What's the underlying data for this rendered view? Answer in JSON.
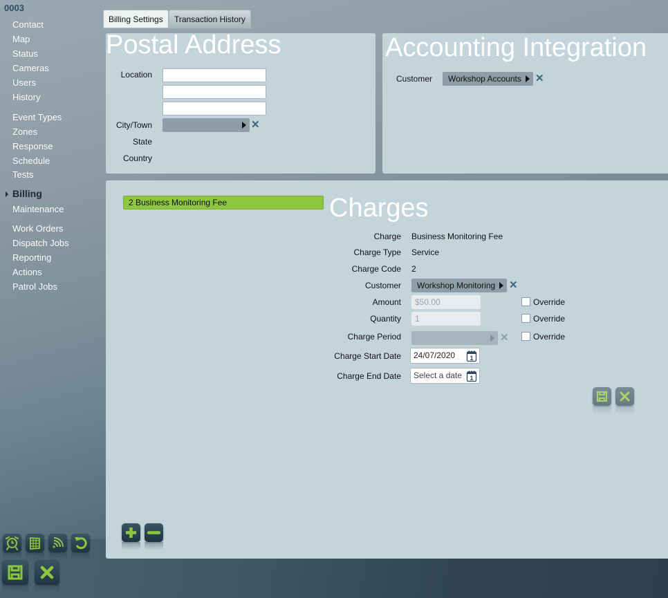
{
  "sidebar": {
    "record_id": "0003",
    "items": [
      {
        "label": "Contact"
      },
      {
        "label": "Map"
      },
      {
        "label": "Status"
      },
      {
        "label": "Cameras"
      },
      {
        "label": "Users"
      },
      {
        "label": "History"
      },
      {
        "label": "Event Types"
      },
      {
        "label": "Zones"
      },
      {
        "label": "Response"
      },
      {
        "label": "Schedule"
      },
      {
        "label": "Tests"
      },
      {
        "label": "Billing",
        "active": true
      },
      {
        "label": "Maintenance"
      },
      {
        "label": "Work Orders"
      },
      {
        "label": "Dispatch Jobs"
      },
      {
        "label": "Reporting"
      },
      {
        "label": "Actions"
      },
      {
        "label": "Patrol Jobs"
      }
    ],
    "toolbar_icons": [
      "alarm-clock-icon",
      "building-icon",
      "signal-icon",
      "undo-icon"
    ],
    "save_icon": "save-icon",
    "cancel_icon": "close-icon"
  },
  "tabs": [
    {
      "label": "Billing Settings",
      "active": true
    },
    {
      "label": "Transaction History",
      "active": false
    }
  ],
  "postal_address": {
    "title": "Postal Address",
    "location_label": "Location",
    "location_lines": [
      "",
      "",
      ""
    ],
    "city_label": "City/Town",
    "city_value": "",
    "state_label": "State",
    "state_value": "",
    "country_label": "Country",
    "country_value": ""
  },
  "accounting": {
    "title": "Accounting Integration",
    "customer_label": "Customer",
    "customer_value": "Workshop Accounts"
  },
  "charges": {
    "title": "Charges",
    "list": [
      {
        "code": "2",
        "name": "Business Monitoring Fee",
        "selected": true
      }
    ],
    "selected_item_label": "2  Business Monitoring Fee",
    "fields": {
      "charge_label": "Charge",
      "charge_value": "Business Monitoring Fee",
      "charge_type_label": "Charge Type",
      "charge_type_value": "Service",
      "charge_code_label": "Charge Code",
      "charge_code_value": "2",
      "customer_label": "Customer",
      "customer_value": "Workshop Monitoring",
      "amount_label": "Amount",
      "amount_value": "$50.00",
      "quantity_label": "Quantity",
      "quantity_value": "1",
      "charge_period_label": "Charge Period",
      "charge_period_value": "",
      "override_label": "Override",
      "start_date_label": "Charge Start Date",
      "start_date_value": "24/07/2020",
      "end_date_label": "Charge End Date",
      "end_date_placeholder": "Select a date"
    },
    "overrides": {
      "amount": false,
      "quantity": false,
      "charge_period": false
    }
  },
  "colors": {
    "accent_green": "#8dc63f",
    "panel_bg": "#c3d4db",
    "icon_green": "#8dc63f"
  }
}
